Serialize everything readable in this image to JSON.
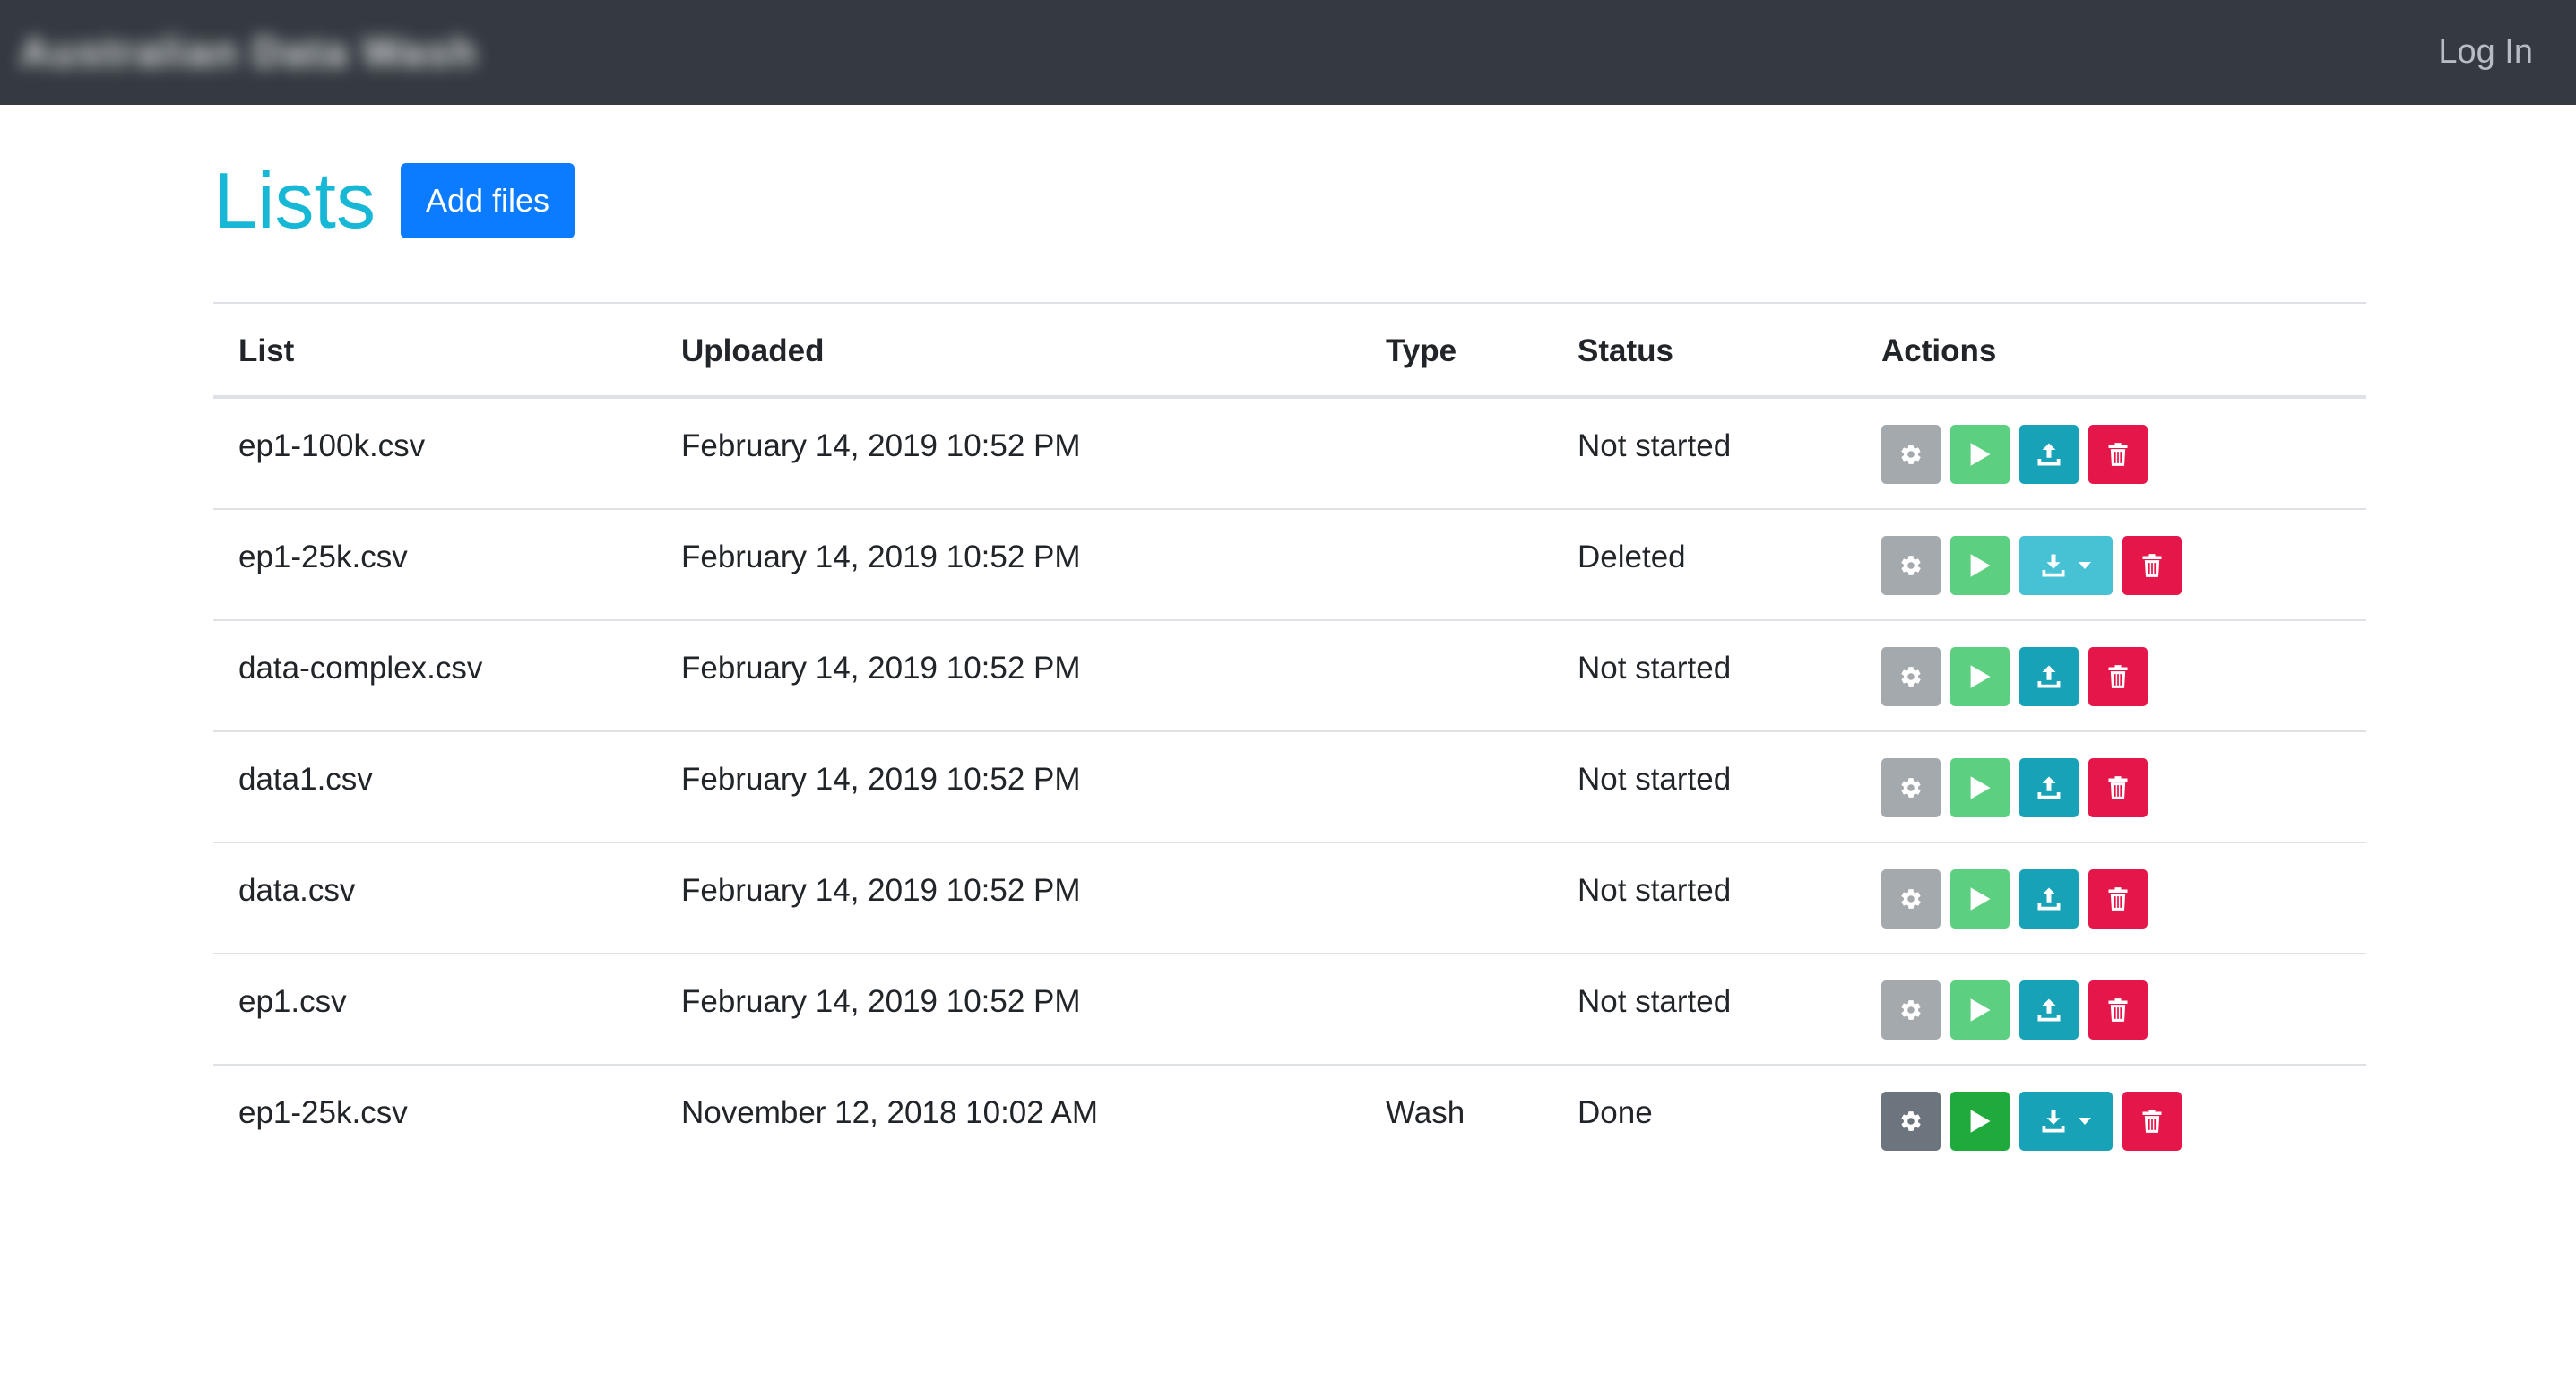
{
  "navbar": {
    "brand": "Australian Data Wash",
    "login_label": "Log In"
  },
  "page": {
    "title": "Lists",
    "add_files_label": "Add files"
  },
  "table": {
    "headers": [
      "List",
      "Uploaded",
      "Type",
      "Status",
      "Actions"
    ],
    "rows": [
      {
        "list": "ep1-100k.csv",
        "uploaded": "February 14, 2019 10:52 PM",
        "type": "",
        "status": "Not started"
      },
      {
        "list": "ep1-25k.csv",
        "uploaded": "February 14, 2019 10:52 PM",
        "type": "",
        "status": "Deleted"
      },
      {
        "list": "data-complex.csv",
        "uploaded": "February 14, 2019 10:52 PM",
        "type": "",
        "status": "Not started"
      },
      {
        "list": "data1.csv",
        "uploaded": "February 14, 2019 10:52 PM",
        "type": "",
        "status": "Not started"
      },
      {
        "list": "data.csv",
        "uploaded": "February 14, 2019 10:52 PM",
        "type": "",
        "status": "Not started"
      },
      {
        "list": "ep1.csv",
        "uploaded": "February 14, 2019 10:52 PM",
        "type": "",
        "status": "Not started"
      },
      {
        "list": "ep1-25k.csv",
        "uploaded": "November 12, 2018 10:02 AM",
        "type": "Wash",
        "status": "Done"
      }
    ]
  },
  "action_icons": [
    "gear-icon",
    "play-icon",
    "upload-icon",
    "download-icon",
    "caret-down-icon",
    "trash-icon"
  ],
  "colors": {
    "navbar": "#343a40",
    "title": "#17b8d6",
    "primary": "#0b7cff",
    "secondary": "#a4a9ae",
    "success": "#5ccf80",
    "info": "#17a2b8",
    "danger": "#e5174a"
  }
}
